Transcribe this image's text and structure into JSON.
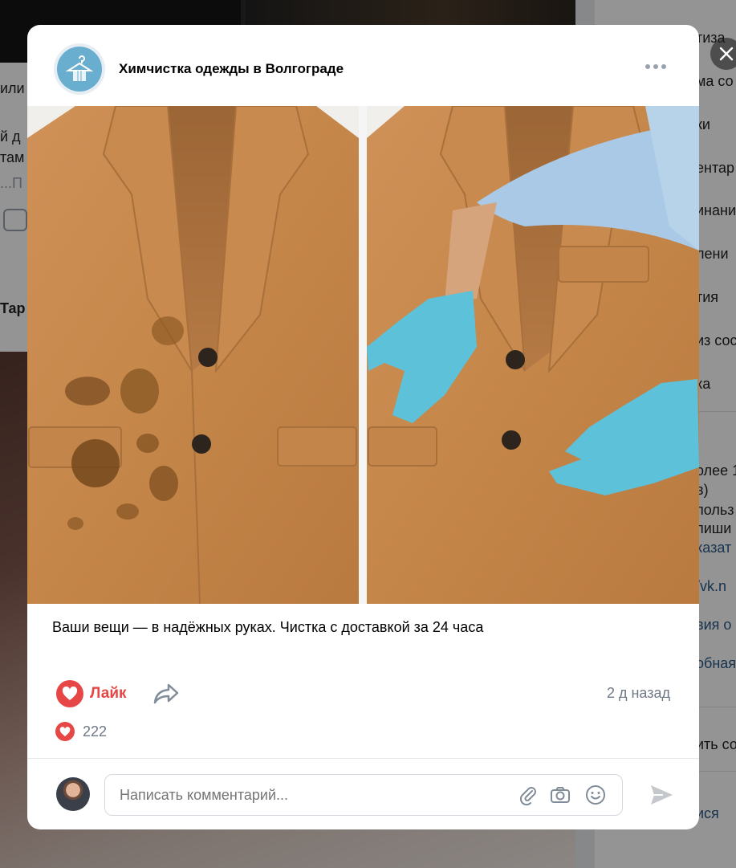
{
  "background": {
    "left_snippets": [
      "или",
      "й д",
      "там",
      "...П",
      "Тар"
    ],
    "right_snippets": [
      "тиза",
      "ма со",
      "ки",
      "ентар",
      "инани",
      "лени",
      "тия",
      "из сос",
      "ка",
      "олее 1",
      "в)",
      "польз",
      "пиши",
      "казат",
      "/vk.n",
      "вия о",
      "обная",
      "ить со",
      "ися"
    ]
  },
  "post": {
    "group_name": "Химчистка одежды в Волгограде",
    "text": "Ваши вещи — в надёжных руках. Чистка с доставкой за 24 часа",
    "like_label": "Лайк",
    "time": "2 д назад",
    "likes_count": "222"
  },
  "comment": {
    "placeholder": "Написать комментарий..."
  },
  "colors": {
    "accent_red": "#e64646",
    "muted": "#6f7985",
    "camel": "#c98a4f"
  },
  "icons": [
    "close-icon",
    "more-icon",
    "hanger-icon",
    "heart-icon",
    "share-icon",
    "attach-icon",
    "camera-icon",
    "smile-icon",
    "send-icon"
  ]
}
